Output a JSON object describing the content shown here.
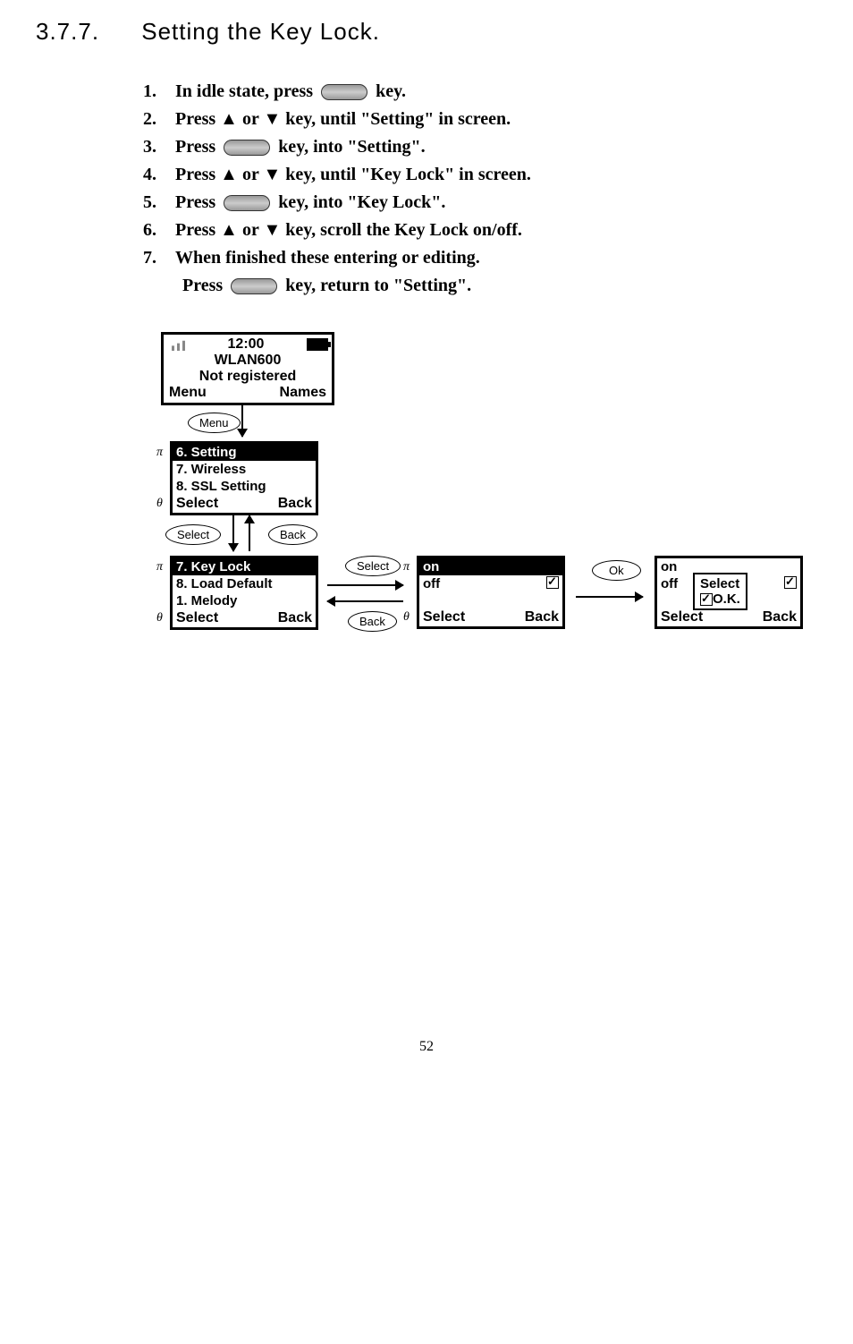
{
  "section": {
    "number": "3.7.7.",
    "title": "Setting the Key Lock."
  },
  "steps": [
    {
      "num": "1.",
      "text_before": "In idle state, press ",
      "text_after": " key."
    },
    {
      "num": "2.",
      "text": "Press ▲ or ▼ key, until \"Setting\" in screen."
    },
    {
      "num": "3.",
      "text_before": "Press ",
      "text_after": " key, into \"Setting\"."
    },
    {
      "num": "4.",
      "text": "Press ▲ or ▼ key, until \"Key Lock\" in screen."
    },
    {
      "num": "5.",
      "text_before": "Press ",
      "text_after": " key, into \"Key Lock\"."
    },
    {
      "num": "6.",
      "text": "Press ▲ or ▼ key, scroll the Key Lock on/off."
    },
    {
      "num": "7.",
      "text": "When finished these entering or editing."
    }
  ],
  "step7_sub": {
    "text_before": "Press ",
    "text_after": " key, return to \"Setting\"."
  },
  "idle_screen": {
    "time": "12:00",
    "line2": "WLAN600",
    "line3": "Not registered",
    "soft_left": "Menu",
    "soft_right": "Names"
  },
  "btn_menu": "Menu",
  "menu1": {
    "item1": "6. Setting",
    "item2": "7. Wireless",
    "item3": "8. SSL Setting",
    "soft_left": "Select",
    "soft_right": "Back"
  },
  "btn_select": "Select",
  "btn_back": "Back",
  "menu2": {
    "item1": "7. Key Lock",
    "item2": "8. Load Default",
    "item3": "1. Melody",
    "soft_left": "Select",
    "soft_right": "Back"
  },
  "btn_select2": "Select",
  "btn_back2": "Back",
  "menu3": {
    "item1": "on",
    "item2": "off",
    "soft_left": "Select",
    "soft_right": "Back"
  },
  "btn_ok": "Ok",
  "menu4": {
    "item1": "on",
    "item2": "off",
    "soft_left": "Select",
    "soft_right": "Back",
    "popup_line1": "Select",
    "popup_line2": "O.K."
  },
  "pi": "π",
  "theta": "θ",
  "page_number": "52"
}
